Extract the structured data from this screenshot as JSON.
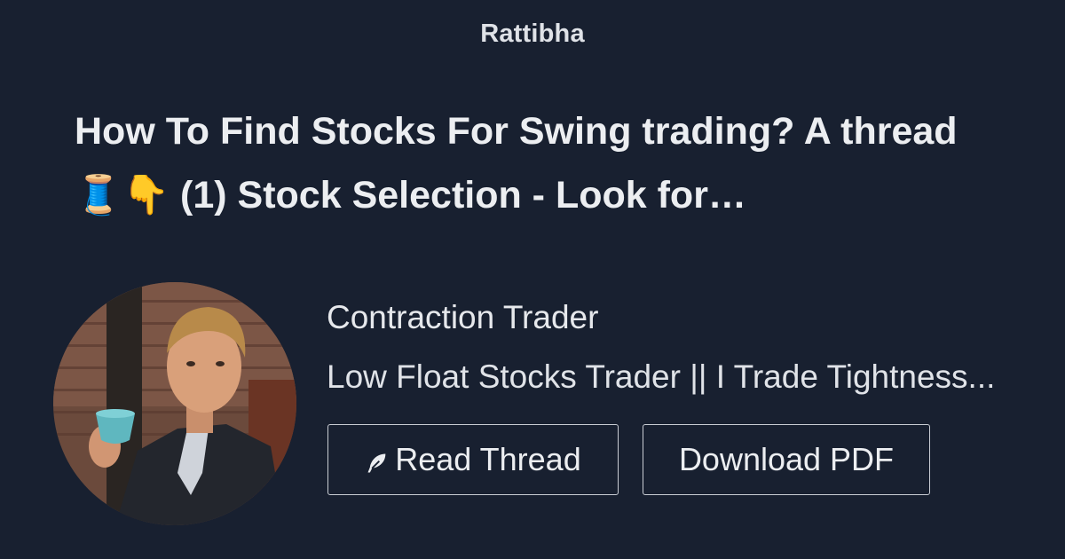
{
  "brand": {
    "name": "Rattibha"
  },
  "thread": {
    "title": "How To Find Stocks For Swing trading? A thread 🧵👇 (1) Stock Selection - Look for…"
  },
  "author": {
    "name": "Contraction Trader",
    "bio": "Low Float Stocks Trader || I Trade Tightness..."
  },
  "actions": {
    "read_label": "Read Thread",
    "read_icon": "feather-icon",
    "pdf_label": "Download PDF"
  },
  "colors": {
    "background": "#182030",
    "text": "#e6e8ec",
    "button_border": "#c9cdd4"
  }
}
